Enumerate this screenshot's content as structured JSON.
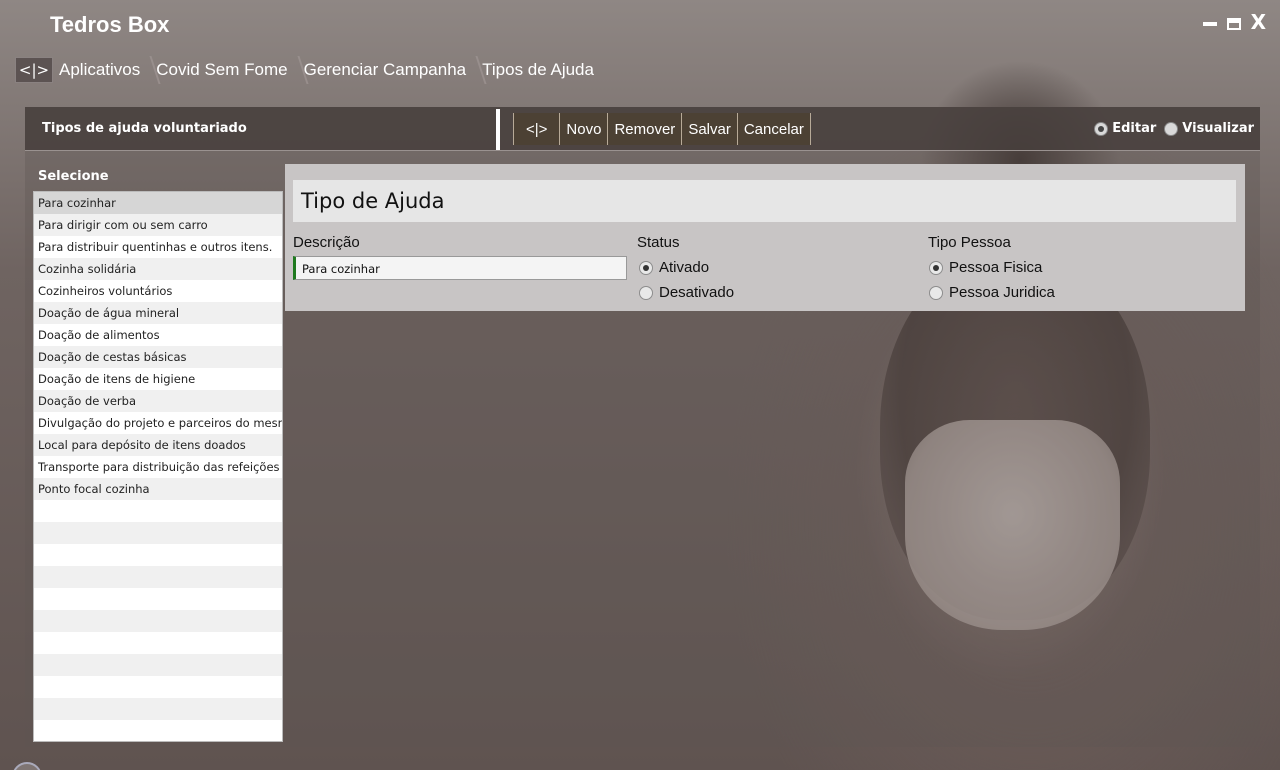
{
  "app": {
    "title": "Tedros Box"
  },
  "window": {
    "minimize": "_",
    "maximize": "□",
    "close": "X"
  },
  "breadcrumb": {
    "home_label": "<|>",
    "items": [
      "Aplicativos",
      "Covid Sem Fome",
      "Gerenciar Campanha",
      "Tipos de Ajuda"
    ]
  },
  "panel": {
    "title": "Tipos de ajuda voluntariado",
    "toolbar": {
      "back_label": "<|>",
      "new_label": "Novo",
      "remove_label": "Remover",
      "save_label": "Salvar",
      "cancel_label": "Cancelar"
    },
    "mode": {
      "edit_label": "Editar",
      "view_label": "Visualizar",
      "selected": "Editar"
    }
  },
  "list": {
    "label": "Selecione",
    "items": [
      "Para cozinhar",
      "Para dirigir com ou sem carro",
      "Para distribuir quentinhas e outros itens.",
      "Cozinha solidária",
      "Cozinheiros voluntários",
      "Doação de água mineral",
      "Doação de alimentos",
      "Doação de cestas básicas",
      "Doação de itens de higiene",
      "Doação de verba",
      "Divulgação do projeto e parceiros do mesmo",
      "Local para depósito de itens doados",
      "Transporte para distribuição das refeições",
      "Ponto focal cozinha"
    ],
    "selected_index": 0
  },
  "form": {
    "title": "Tipo de Ajuda",
    "description": {
      "label": "Descrição",
      "value": "Para cozinhar"
    },
    "status": {
      "label": "Status",
      "options": [
        "Ativado",
        "Desativado"
      ],
      "selected": "Ativado"
    },
    "person_type": {
      "label": "Tipo Pessoa",
      "options": [
        "Pessoa Fisica",
        "Pessoa Juridica"
      ],
      "selected": "Pessoa Fisica"
    }
  },
  "colors": {
    "toolbar_bg": "#4c4134",
    "selected_row": "#d6d6d6",
    "input_accent": "#1f7a1f"
  }
}
